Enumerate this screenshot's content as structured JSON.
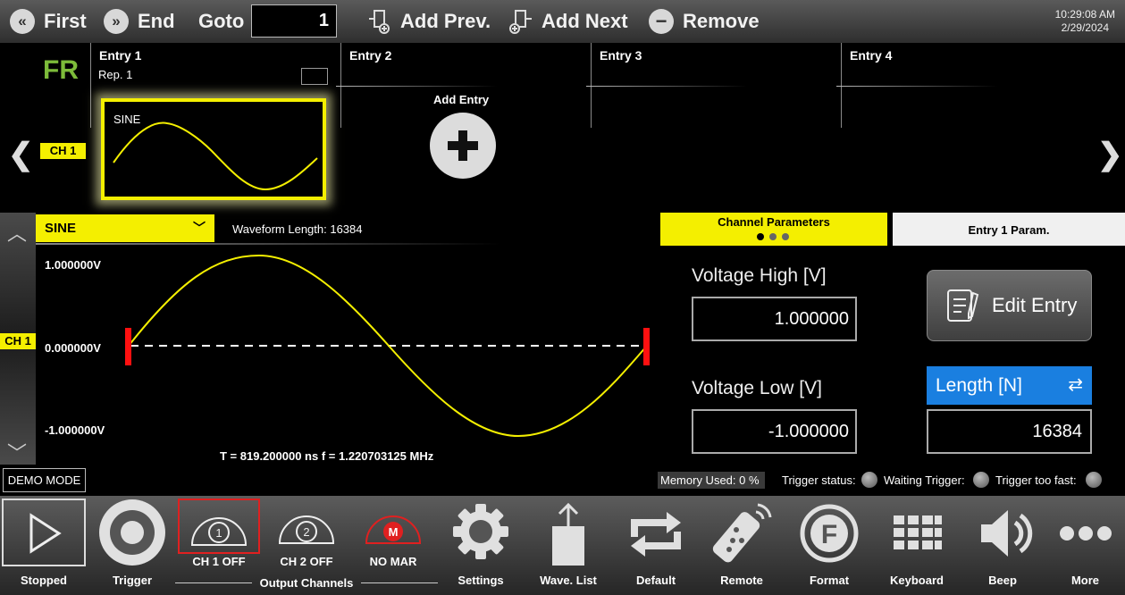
{
  "toolbar": {
    "first_label": "First",
    "end_label": "End",
    "goto_label": "Goto",
    "goto_value": "1",
    "add_prev_label": "Add Prev.",
    "add_next_label": "Add Next",
    "remove_label": "Remove",
    "time": "10:29:08 AM",
    "date": "2/29/2024"
  },
  "sequence": {
    "mode_label": "FR",
    "channel_tag": "CH 1",
    "entries": [
      {
        "title": "Entry  1"
      },
      {
        "title": "Entry  2"
      },
      {
        "title": "Entry  3"
      },
      {
        "title": "Entry  4"
      }
    ],
    "rep_label": "Rep.  1",
    "card_label": "SINE",
    "add_entry_label": "Add Entry"
  },
  "waveform": {
    "selected": "SINE",
    "length_text": "Waveform Length:  16384",
    "v_high": "1.000000V",
    "v_zero": "0.000000V",
    "v_low": "-1.000000V",
    "channel_tag": "CH 1",
    "period_text": "T  =  819.200000 ns   f  =  1.220703125 MHz"
  },
  "params": {
    "tab_channel": "Channel Parameters",
    "tab_entry": "Entry  1  Param.",
    "voltage_high_label": "Voltage High [V]",
    "voltage_high_value": "1.000000",
    "voltage_low_label": "Voltage Low [V]",
    "voltage_low_value": "-1.000000",
    "edit_entry_label": "Edit Entry",
    "length_label": "Length [N]",
    "length_value": "16384"
  },
  "status": {
    "demo_mode": "DEMO MODE",
    "memory_used": "Memory Used:   0 %",
    "trigger_status": "Trigger status:",
    "waiting_trigger": "Waiting Trigger:",
    "trigger_too_fast": "Trigger too fast:"
  },
  "bottom": {
    "stopped": "Stopped",
    "trigger": "Trigger",
    "ch1": "CH 1 OFF",
    "ch2": "CH 2 OFF",
    "nomar": "NO MAR",
    "output_channels": "Output Channels",
    "settings": "Settings",
    "wave_list": "Wave. List",
    "default": "Default",
    "remote": "Remote",
    "format": "Format",
    "keyboard": "Keyboard",
    "beep": "Beep",
    "more": "More",
    "ch1_num": "1",
    "ch2_num": "2",
    "marker_letter": "M",
    "format_letter": "F"
  },
  "colors": {
    "accent_yellow": "#f4ef00",
    "length_blue": "#1a7fe0",
    "marker_red": "#e02020",
    "fr_green": "#7dbb3a"
  }
}
